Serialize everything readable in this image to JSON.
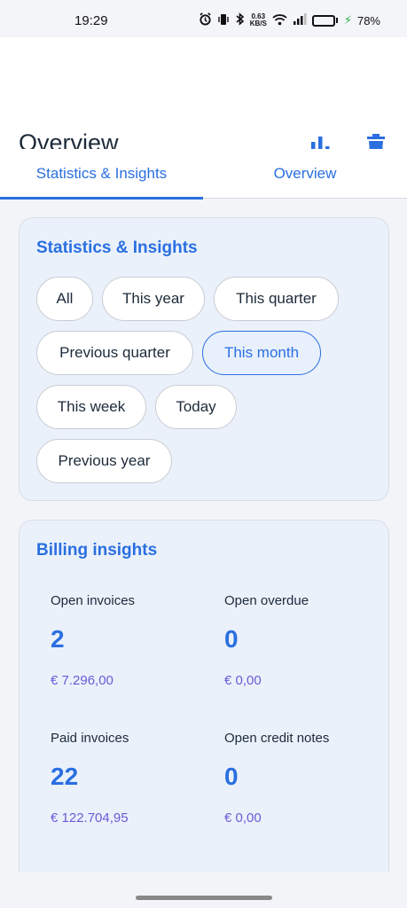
{
  "status_bar": {
    "time": "19:29",
    "net_speed_value": "0.63",
    "net_speed_unit": "KB/S",
    "battery_level": 0.78,
    "battery_label": "78%"
  },
  "app_bar": {
    "title": "Overview",
    "actions": [
      "bar-chart-icon",
      "trash-icon"
    ]
  },
  "tabs": [
    {
      "label": "Statistics & Insights",
      "selected": true
    },
    {
      "label": "Overview",
      "selected": false
    }
  ],
  "filter_card": {
    "title": "Statistics & Insights",
    "chips": [
      {
        "label": "All",
        "selected": false
      },
      {
        "label": "This year",
        "selected": false
      },
      {
        "label": "This quarter",
        "selected": false
      },
      {
        "label": "Previous quarter",
        "selected": false
      },
      {
        "label": "This month",
        "selected": true
      },
      {
        "label": "This week",
        "selected": false
      },
      {
        "label": "Today",
        "selected": false
      },
      {
        "label": "Previous year",
        "selected": false
      }
    ]
  },
  "billing_card": {
    "title": "Billing insights",
    "stats": [
      {
        "label": "Open invoices",
        "value": "2",
        "amount": "€ 7.296,00"
      },
      {
        "label": "Open overdue",
        "value": "0",
        "amount": "€ 0,00"
      },
      {
        "label": "Paid invoices",
        "value": "22",
        "amount": "€ 122.704,95"
      },
      {
        "label": "Open credit notes",
        "value": "0",
        "amount": "€ 0,00"
      }
    ]
  },
  "colors": {
    "accent": "#2a6fe0",
    "amount": "#6b5bd6",
    "card_bg": "#eaf1fb",
    "page_bg": "#f2f4f8"
  }
}
